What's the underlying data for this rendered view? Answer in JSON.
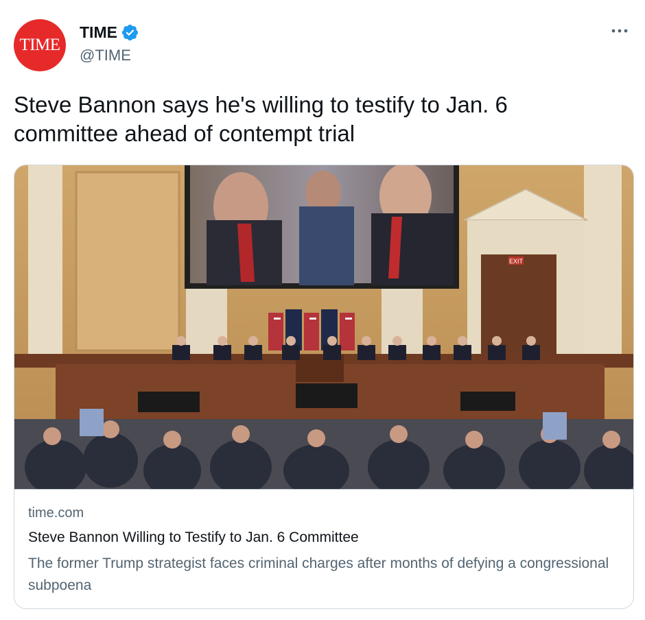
{
  "tweet": {
    "author": {
      "display_name": "TIME",
      "handle": "@TIME",
      "avatar_text": "TIME",
      "verified": true
    },
    "text": "Steve Bannon says he's willing to testify to Jan. 6 committee ahead of contempt trial",
    "card": {
      "image_icon": "hearing-room-photo",
      "domain": "time.com",
      "title": "Steve Bannon Willing to Testify to Jan. 6 Committee",
      "description": "The former Trump strategist faces criminal charges after months of defying a congressional subpoena",
      "photo_sign_text": "EXIT"
    }
  },
  "colors": {
    "avatar_bg": "#e62a2a",
    "verified_blue": "#1d9bf0",
    "text_primary": "#0f1419",
    "text_secondary": "#536471",
    "card_border": "#cfd9de"
  }
}
